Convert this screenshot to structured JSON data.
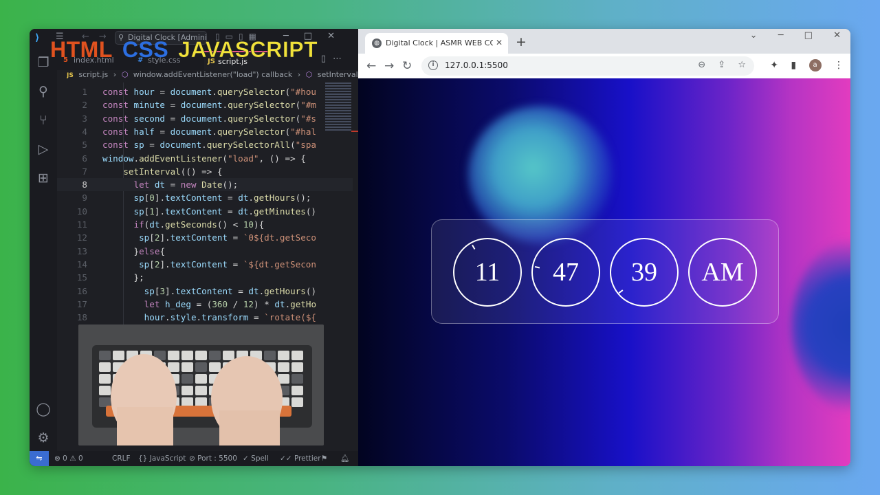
{
  "overlay": {
    "html": "HTML",
    "css": "CSS",
    "js": "JAVASCRIPT"
  },
  "vscode": {
    "search": "Digital Clock [Administ...",
    "tabs": [
      {
        "label": "index.html",
        "icon": "html"
      },
      {
        "label": "style.css",
        "icon": "css"
      },
      {
        "label": "script.js",
        "icon": "js",
        "active": true
      }
    ],
    "breadcrumbs": [
      "script.js",
      "window.addEventListener(\"load\") callback",
      "setInterval() callback"
    ],
    "code_lines": [
      {
        "n": "1",
        "text": "const hour = document.querySelector(\"#hou"
      },
      {
        "n": "2",
        "text": "const minute = document.querySelector(\"#m"
      },
      {
        "n": "3",
        "text": "const second = document.querySelector(\"#s"
      },
      {
        "n": "4",
        "text": "const half = document.querySelector(\"#hal"
      },
      {
        "n": "5",
        "text": "const sp = document.querySelectorAll(\"spa"
      },
      {
        "n": "6",
        "text": "window.addEventListener(\"load\", () => {"
      },
      {
        "n": "7",
        "text": "    setInterval(() => {"
      },
      {
        "n": "8",
        "text": "      let dt = new Date();"
      },
      {
        "n": "9",
        "text": "      sp[0].textContent = dt.getHours();"
      },
      {
        "n": "10",
        "text": "      sp[1].textContent = dt.getMinutes()"
      },
      {
        "n": "11",
        "text": "      if(dt.getSeconds() < 10){"
      },
      {
        "n": "12",
        "text": "       sp[2].textContent = `0${dt.getSeco"
      },
      {
        "n": "13",
        "text": "      }else{"
      },
      {
        "n": "14",
        "text": "       sp[2].textContent = `${dt.getSecon"
      },
      {
        "n": "15",
        "text": "      };"
      },
      {
        "n": "16",
        "text": "        sp[3].textContent = dt.getHours()"
      },
      {
        "n": "17",
        "text": "        let h_deg = (360 / 12) * dt.getHo"
      },
      {
        "n": "18",
        "text": "        hour.style.transform = `rotate(${"
      }
    ],
    "current_line": "8",
    "status": {
      "errors": "0",
      "warnings": "0",
      "eol": "CRLF",
      "language": "JavaScript",
      "port": "Port : 5500",
      "spell": "Spell",
      "prettier": "Prettier"
    }
  },
  "chrome": {
    "tab_title": "Digital Clock | ASMR WEB CODIN",
    "url": "127.0.0.1:5500",
    "avatar_letter": "a"
  },
  "clock": {
    "hours": "11",
    "minutes": "47",
    "seconds": "39",
    "ampm": "AM",
    "hour_hand_deg": 330,
    "minute_hand_deg": 282,
    "second_hand_deg": 234
  },
  "colors": {
    "html": "#e0521f",
    "css": "#2c6ee0",
    "js": "#f1e23a",
    "keyword": "#c586c0",
    "variable": "#9cdcfe",
    "function": "#dcdcaa",
    "string": "#ce9178",
    "number": "#b5cea8",
    "punct": "#d4d4d4",
    "type": "#4ec9b0"
  }
}
